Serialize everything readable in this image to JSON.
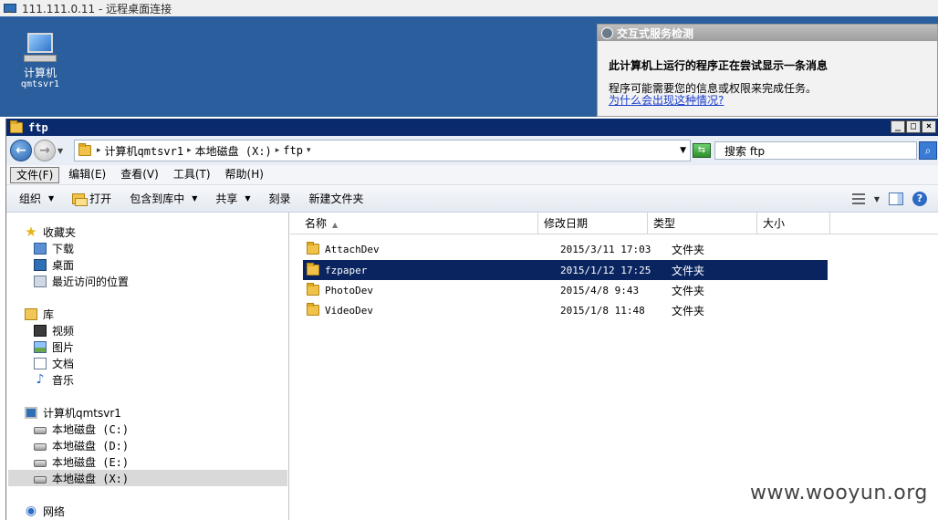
{
  "rdp": {
    "title": "111.111.0.11 - 远程桌面连接"
  },
  "desktop": {
    "icon_label": "计算机",
    "icon_sublabel": "qmtsvr1"
  },
  "popup": {
    "title": "交互式服务检测",
    "heading": "此计算机上运行的程序正在尝试显示一条消息",
    "body": "程序可能需要您的信息或权限来完成任务。",
    "link": "为什么会出现这种情况?"
  },
  "window": {
    "title": "ftp",
    "controls": {
      "minimize": "_",
      "maximize": "□",
      "close": "×"
    }
  },
  "address": {
    "breadcrumbs": [
      "计算机qmtsvr1",
      "本地磁盘 (X:)",
      "ftp"
    ],
    "search_value": "搜索 ftp"
  },
  "menu": [
    "文件(F)",
    "编辑(E)",
    "查看(V)",
    "工具(T)",
    "帮助(H)"
  ],
  "commands": {
    "organize": "组织",
    "open": "打开",
    "include_library": "包含到库中",
    "share": "共享",
    "burn": "刻录",
    "new_folder": "新建文件夹",
    "help": "?"
  },
  "nav": {
    "favorites": "收藏夹",
    "downloads": "下载",
    "desktop": "桌面",
    "recent": "最近访问的位置",
    "libraries": "库",
    "videos": "视频",
    "pictures": "图片",
    "documents": "文档",
    "music": "音乐",
    "computer": "计算机qmtsvr1",
    "drive_c": "本地磁盘 (C:)",
    "drive_d": "本地磁盘 (D:)",
    "drive_e": "本地磁盘 (E:)",
    "drive_x": "本地磁盘 (X:)",
    "network": "网络"
  },
  "columns": {
    "name": "名称",
    "modified": "修改日期",
    "type": "类型",
    "size": "大小"
  },
  "files": [
    {
      "name": "AttachDev",
      "modified": "2015/3/11 17:03",
      "type": "文件夹"
    },
    {
      "name": "fzpaper",
      "modified": "2015/1/12 17:25",
      "type": "文件夹"
    },
    {
      "name": "PhotoDev",
      "modified": "2015/4/8 9:43",
      "type": "文件夹"
    },
    {
      "name": "VideoDev",
      "modified": "2015/1/8 11:48",
      "type": "文件夹"
    }
  ],
  "watermark": "www.wooyun.org",
  "colors": {
    "desktop": "#2b5e9c",
    "title_bar": "#0a2a6e",
    "selection": "#0a2460"
  }
}
